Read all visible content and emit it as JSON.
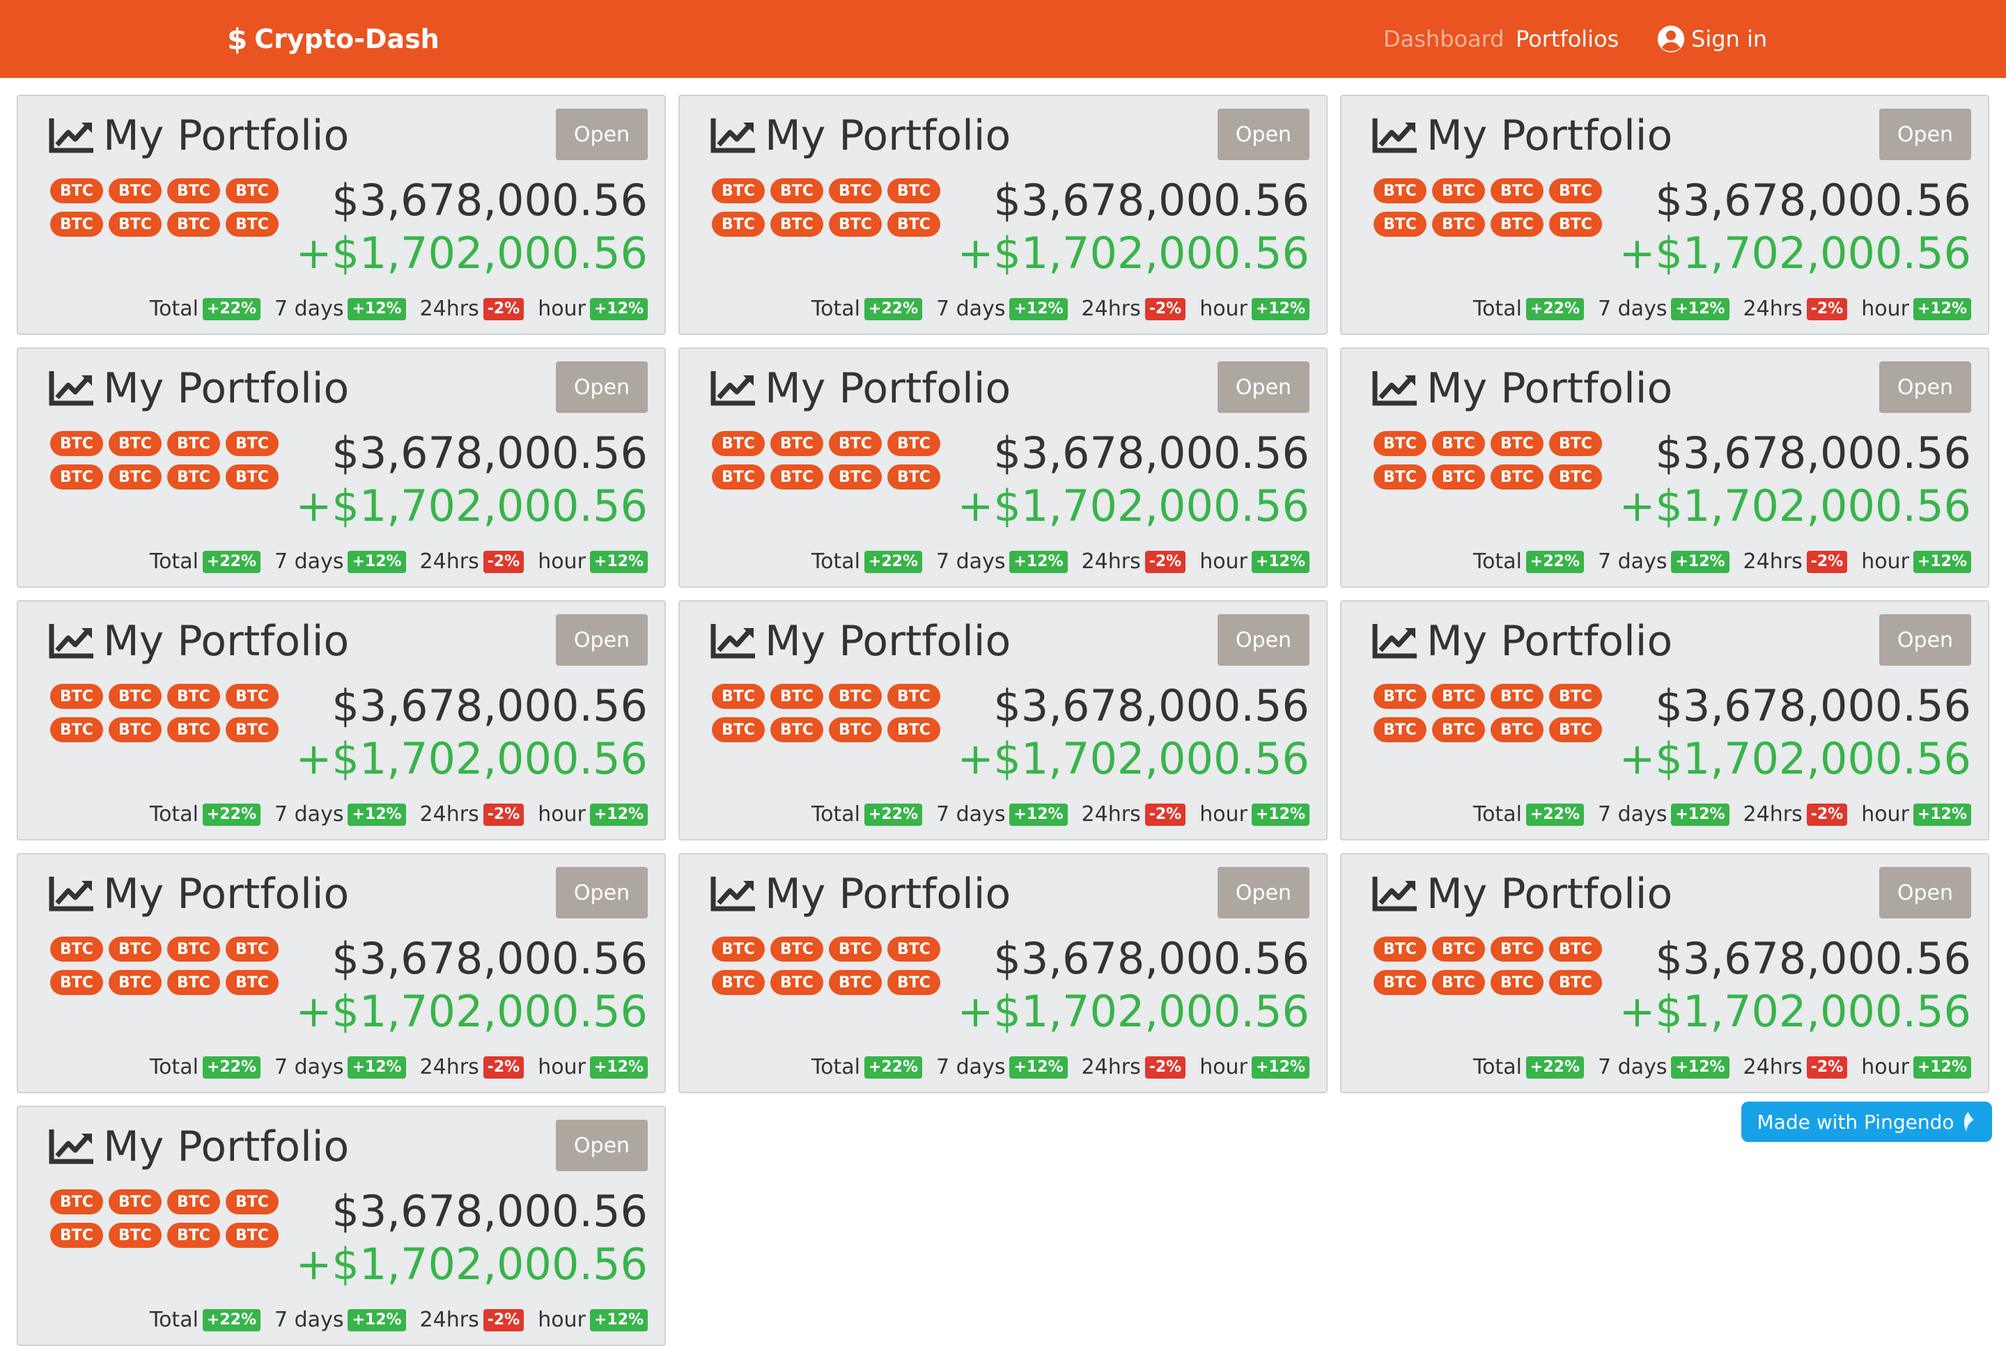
{
  "nav": {
    "brand_symbol": "$",
    "brand": "Crypto-Dash",
    "links": [
      "Dashboard",
      "Portfolios"
    ],
    "signin": "Sign in"
  },
  "card": {
    "title": "My Portfolio",
    "open_label": "Open",
    "coins": [
      "BTC",
      "BTC",
      "BTC",
      "BTC",
      "BTC",
      "BTC",
      "BTC",
      "BTC"
    ],
    "value": "$3,678,000.56",
    "gain": "+$1,702,000.56",
    "stats": [
      {
        "label": "Total",
        "badge": "+22%",
        "positive": true
      },
      {
        "label": "7 days",
        "badge": "+12%",
        "positive": true
      },
      {
        "label": "24hrs",
        "badge": "-2%",
        "positive": false
      },
      {
        "label": "hour",
        "badge": "+12%",
        "positive": true
      }
    ]
  },
  "card_count": 13,
  "footer_badge": "Made with Pingendo",
  "colors": {
    "primary": "#e95420",
    "success": "#38b44a",
    "danger": "#df382c",
    "secondary": "#aea79f",
    "card_bg": "#e9ebed",
    "badge_blue": "#17a2e8"
  }
}
